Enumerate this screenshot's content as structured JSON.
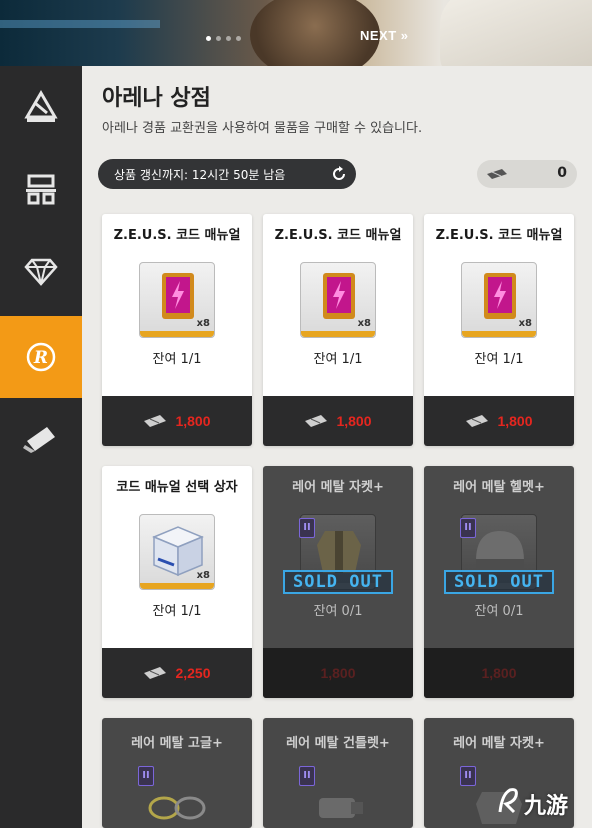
{
  "banner": {
    "next_label": "NEXT »",
    "page_dots": 4,
    "active_dot": 0
  },
  "sidebar": {
    "items": [
      {
        "icon": "arena-icon",
        "active": false
      },
      {
        "icon": "shop-building-icon",
        "active": false
      },
      {
        "icon": "diamond-icon",
        "active": false
      },
      {
        "icon": "arena-r-icon",
        "active": true
      },
      {
        "icon": "ticket-icon",
        "active": false
      }
    ]
  },
  "header": {
    "title": "아레나 상점",
    "subtitle": "아레나 경품 교환권을 사용하여 물품을 구매할 수 있습니다."
  },
  "refresh": {
    "text": "상품 갱신까지: 12시간 50분 남음"
  },
  "currency": {
    "icon": "arena-ticket-icon",
    "amount": "0"
  },
  "items": [
    {
      "name": "Z.E.U.S. 코드 매뉴얼",
      "qty": "x8",
      "remain": "잔여 1/1",
      "price": "1,800",
      "sold_out": false,
      "icon": "code-manual-icon"
    },
    {
      "name": "Z.E.U.S. 코드 매뉴얼",
      "qty": "x8",
      "remain": "잔여 1/1",
      "price": "1,800",
      "sold_out": false,
      "icon": "code-manual-icon"
    },
    {
      "name": "Z.E.U.S. 코드 매뉴얼",
      "qty": "x8",
      "remain": "잔여 1/1",
      "price": "1,800",
      "sold_out": false,
      "icon": "code-manual-icon"
    },
    {
      "name": "코드 매뉴얼 선택 상자",
      "qty": "x8",
      "remain": "잔여 1/1",
      "price": "2,250",
      "sold_out": false,
      "icon": "selection-box-icon"
    },
    {
      "name": "레어 메탈 자켓+",
      "remain": "잔여 0/1",
      "price": "1,800",
      "sold_out": true,
      "stamp": "SOLD OUT",
      "badge": "II",
      "icon": "metal-jacket-icon"
    },
    {
      "name": "레어 메탈 헬멧+",
      "remain": "잔여 0/1",
      "price": "1,800",
      "sold_out": true,
      "stamp": "SOLD OUT",
      "badge": "II",
      "icon": "metal-helmet-icon"
    },
    {
      "name": "레어 메탈 고글+",
      "badge": "II",
      "icon": "metal-goggles-icon"
    },
    {
      "name": "레어 메탈 건틀렛+",
      "badge": "II",
      "icon": "metal-gauntlet-icon"
    },
    {
      "name": "레어 메탈 자켓+",
      "badge": "II",
      "icon": "metal-jacket-icon"
    }
  ],
  "watermark": {
    "text": "九游"
  },
  "colors": {
    "accent": "#f39a16",
    "price_red": "#e5261f",
    "sold_out_blue": "#45b4f0",
    "sidebar_bg": "#2a2a2b"
  }
}
